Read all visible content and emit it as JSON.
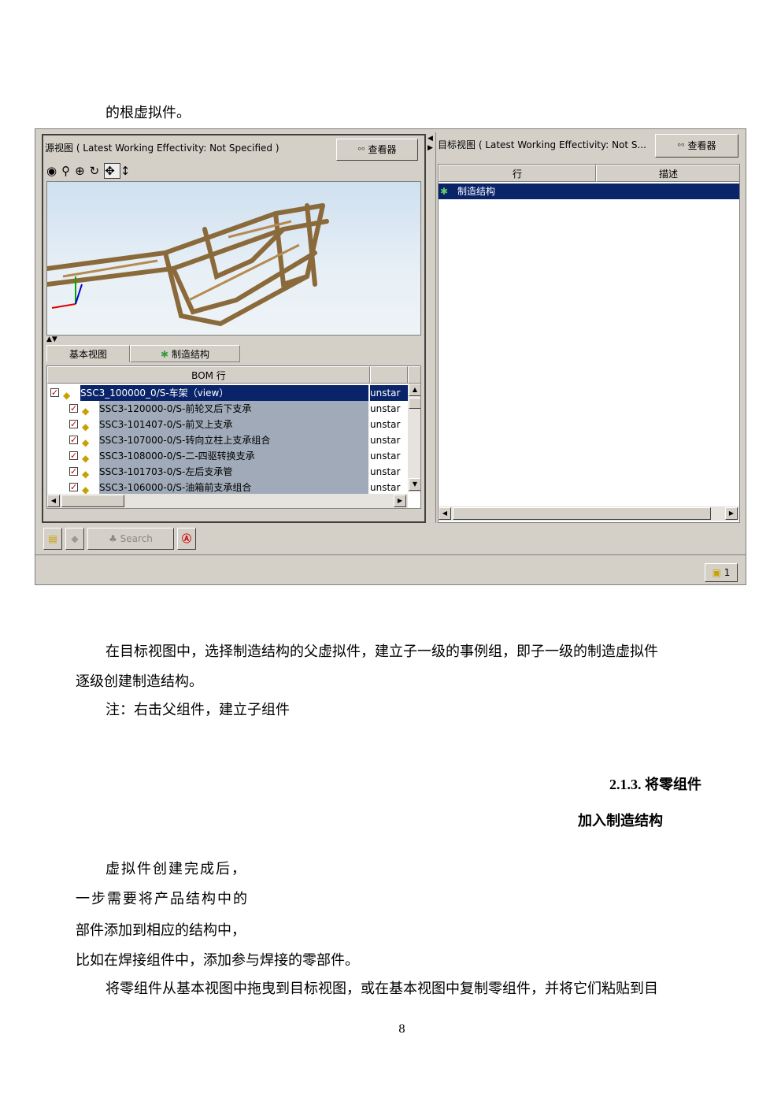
{
  "doc": {
    "intro_line": "的根虚拟件。",
    "para1_line1": "在目标视图中，选择制造结构的父虚拟件，建立子一级的事例组，即子一级的制造虚拟件",
    "para1_line2": "逐级创建制造结构。",
    "note": "注：右击父组件，建立子组件",
    "heading_line1": "2.1.3.  将零组件",
    "heading_line2": "加入制造结构",
    "para2_line1": "虚拟件创建完成后，",
    "para2_line2": "一步需要将产品结构中的",
    "para2_line3": "部件添加到相应的结构中，",
    "para2_line4": "比如在焊接组件中，添加参与焊接的零部件。",
    "para3_line1": "将零组件从基本视图中拖曳到目标视图，或在基本视图中复制零组件，并将它们粘贴到目",
    "page_number": "8"
  },
  "screenshot": {
    "source_view": {
      "title": "源视图 ( Latest Working Effectivity: Not Specified )",
      "viewer_button": "查看器",
      "tabs": [
        "基本视图",
        "制造结构"
      ],
      "bom_header": "BOM 行",
      "rows": [
        {
          "label": "SSC3_100000_0/S-车架（view）",
          "status": "unstar"
        },
        {
          "label": "SSC3-120000-0/S-前轮叉后下支承",
          "status": "unstar"
        },
        {
          "label": "SSC3-101407-0/S-前叉上支承",
          "status": "unstar"
        },
        {
          "label": "SSC3-107000-0/S-转向立柱上支承组合",
          "status": "unstar"
        },
        {
          "label": "SSC3-108000-0/S-二-四驱转换支承",
          "status": "unstar"
        },
        {
          "label": "SSC3-101703-0/S-左后支承管",
          "status": "unstar"
        },
        {
          "label": "SSC3-106000-0/S-油箱前支承组合",
          "status": "unstar"
        }
      ]
    },
    "target_view": {
      "title": "目标视图 ( Latest Working Effectivity: Not S...",
      "viewer_button": "查看器",
      "col_row": "行",
      "col_desc": "描述",
      "item": "制造结构"
    },
    "toolbar": {
      "search_label": "Search"
    },
    "status": {
      "count": "1"
    },
    "icons": [
      "eye-icon",
      "zoom-icon",
      "target-icon",
      "rotate-icon",
      "pan-icon",
      "vertical-pan-icon",
      "glasses-icon",
      "assembly-icon",
      "checkbox-icon"
    ]
  }
}
